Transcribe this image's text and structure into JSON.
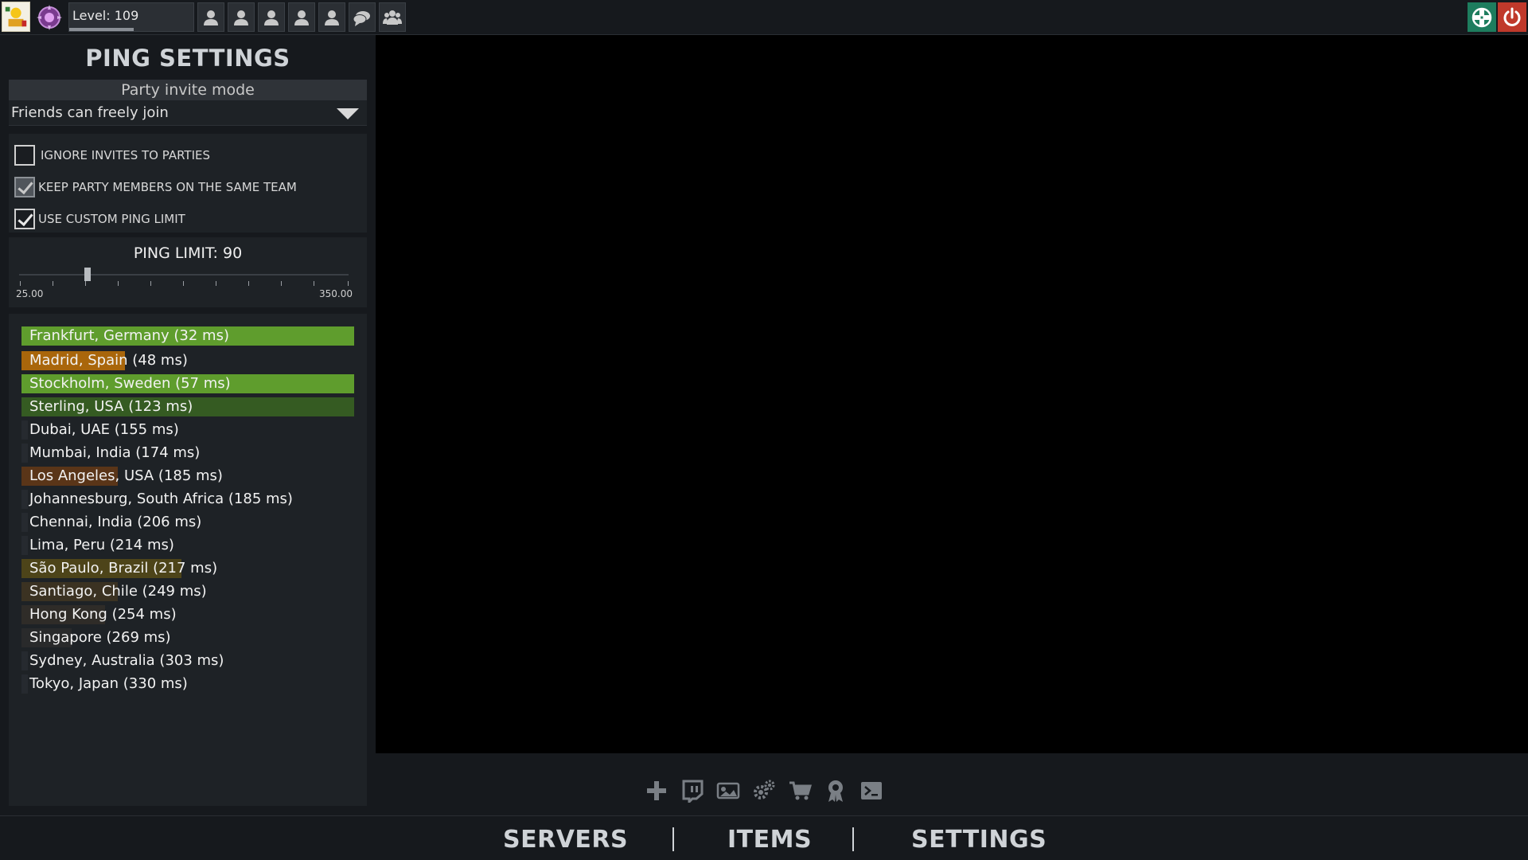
{
  "topbar": {
    "level_label": "Level: 109",
    "level_progress": 0.52,
    "friend_slots": [
      "person-icon",
      "person-icon",
      "person-icon",
      "person-icon",
      "person-icon",
      "chat-icon",
      "group-icon"
    ],
    "right_icons": [
      "health-cross-icon",
      "power-icon"
    ],
    "colors": {
      "health": "#1e7d5e",
      "power": "#c0392b"
    }
  },
  "panel": {
    "title": "PING SETTINGS",
    "party_header": "Party invite mode",
    "party_mode_value": "Friends can freely join",
    "checkboxes": [
      {
        "label": "IGNORE INVITES TO PARTIES",
        "checked": false
      },
      {
        "label": "KEEP PARTY MEMBERS ON THE SAME TEAM",
        "checked": true,
        "disabled": true
      },
      {
        "label": "USE CUSTOM PING LIMIT",
        "checked": true
      }
    ],
    "ping_limit_label": "PING LIMIT: 90",
    "slider": {
      "min_label": "25.00",
      "max_label": "350.00",
      "value": 90,
      "min": 25,
      "max": 350
    },
    "servers": [
      {
        "label": "Frankfurt, Germany (32 ms)",
        "fill_fraction": 1.0,
        "color": "#5f9d2d"
      },
      {
        "label": "Madrid, Spain (48 ms)",
        "fill_fraction": 0.31,
        "color": "#a9660b"
      },
      {
        "label": "Stockholm, Sweden (57 ms)",
        "fill_fraction": 1.0,
        "color": "#5f9d2d"
      },
      {
        "label": "Sterling, USA (123 ms)",
        "fill_fraction": 1.0,
        "color": "#355b22"
      },
      {
        "label": "Dubai, UAE (155 ms)",
        "fill_fraction": 0.02,
        "color": "#262a2f"
      },
      {
        "label": "Mumbai, India (174 ms)",
        "fill_fraction": 0.02,
        "color": "#262a2f"
      },
      {
        "label": "Los Angeles, USA (185 ms)",
        "fill_fraction": 0.29,
        "color": "#5a3518"
      },
      {
        "label": "Johannesburg, South Africa (185 ms)",
        "fill_fraction": 0.02,
        "color": "#262a2f"
      },
      {
        "label": "Chennai, India (206 ms)",
        "fill_fraction": 0.02,
        "color": "#262a2f"
      },
      {
        "label": "Lima, Peru (214 ms)",
        "fill_fraction": 0.02,
        "color": "#262a2f"
      },
      {
        "label": "São Paulo, Brazil (217 ms)",
        "fill_fraction": 0.48,
        "color": "#4d4419"
      },
      {
        "label": "Santiago, Chile (249 ms)",
        "fill_fraction": 0.29,
        "color": "#3b3222"
      },
      {
        "label": "Hong Kong (254 ms)",
        "fill_fraction": 0.25,
        "color": "#2f2c28"
      },
      {
        "label": "Singapore (269 ms)",
        "fill_fraction": 0.15,
        "color": "#292a2b"
      },
      {
        "label": "Sydney, Australia (303 ms)",
        "fill_fraction": 0.02,
        "color": "#262a2f"
      },
      {
        "label": "Tokyo, Japan (330 ms)",
        "fill_fraction": 0.02,
        "color": "#262a2f"
      }
    ]
  },
  "toolbar": {
    "icons": [
      "plus-icon",
      "twitch-icon",
      "media-icon",
      "settings-gears-icon",
      "cart-icon",
      "award-icon",
      "terminal-icon"
    ]
  },
  "bottom_nav": {
    "items": [
      "SERVERS",
      "ITEMS",
      "SETTINGS"
    ]
  }
}
